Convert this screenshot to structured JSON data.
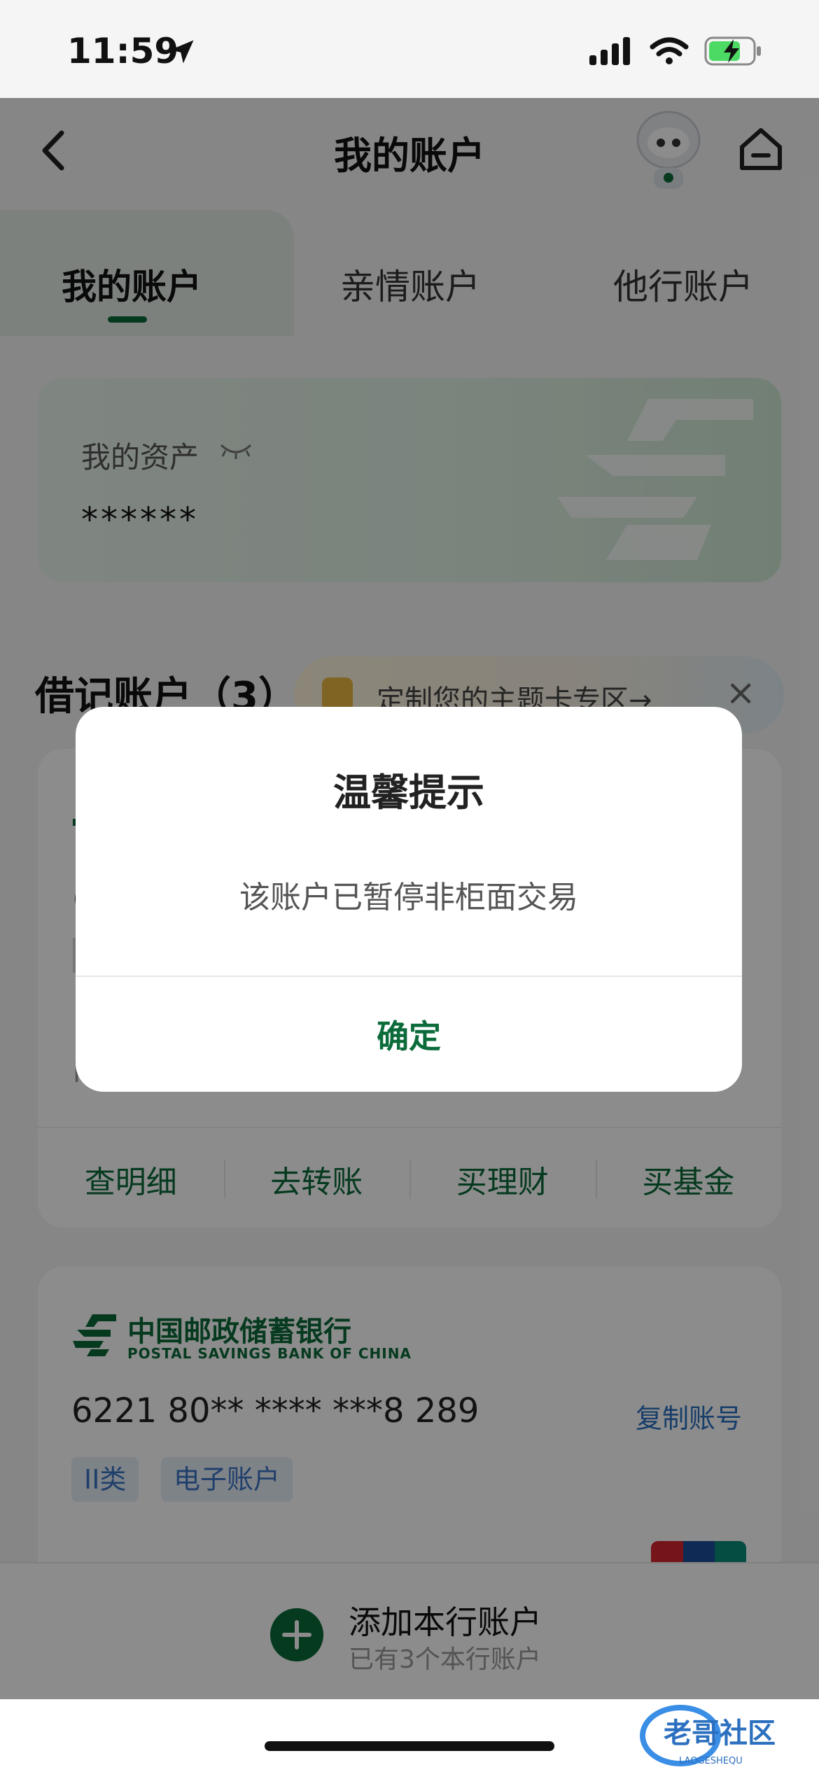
{
  "status_bar": {
    "time": "11:59"
  },
  "nav": {
    "title": "我的账户"
  },
  "tabs": [
    {
      "label": "我的账户"
    },
    {
      "label": "亲情账户"
    },
    {
      "label": "他行账户"
    }
  ],
  "assets": {
    "label": "我的资产",
    "value": "******"
  },
  "debit_section": {
    "title": "借记账户（3）",
    "promo": "定制您的主题卡专区→",
    "promo_close": "×"
  },
  "card1": {
    "actions": [
      "查明细",
      "去转账",
      "买理财",
      "买基金"
    ]
  },
  "card2": {
    "bank_name_cn": "中国邮政储蓄银行",
    "bank_name_en": "POSTAL SAVINGS BANK OF CHINA",
    "number": "6221 80** **** ***8 289",
    "copy_label": "复制账号",
    "tags": [
      "II类",
      "电子账户"
    ]
  },
  "add_account": {
    "title": "添加本行账户",
    "subtitle": "已有3个本行账户"
  },
  "dialog": {
    "title": "温馨提示",
    "message": "该账户已暂停非柜面交易",
    "confirm": "确定"
  },
  "watermark": {
    "text": "老哥社区",
    "sub": "LAOGESHEQU"
  },
  "colors": {
    "accent": "#0b6b3a",
    "link": "#2b6fbf",
    "overlay": "rgba(0,0,0,0.45)"
  }
}
